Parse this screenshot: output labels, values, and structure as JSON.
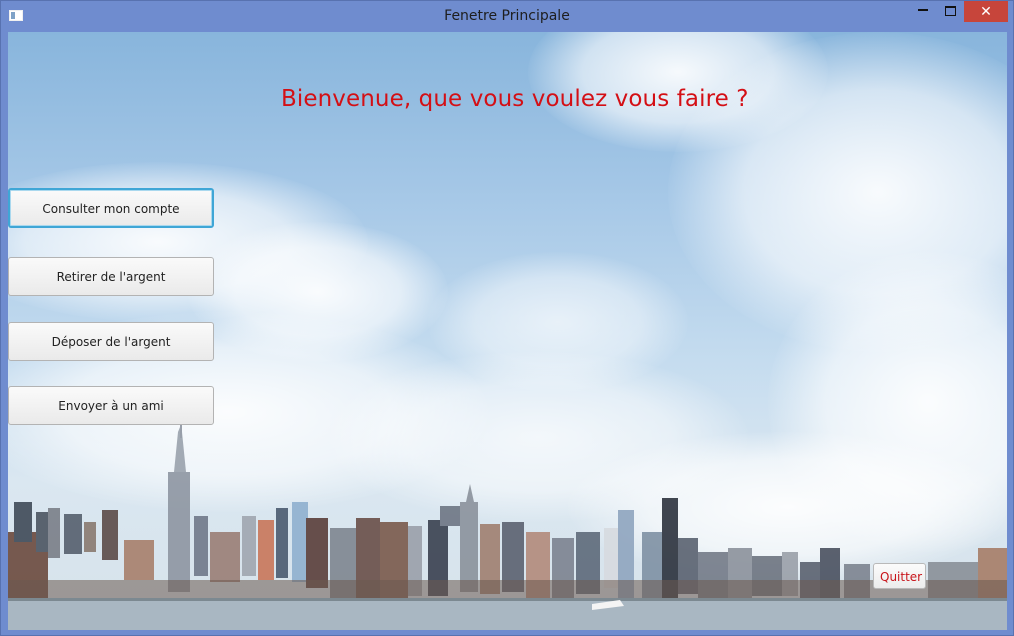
{
  "window": {
    "title": "Fenetre Principale",
    "close_symbol": "✕"
  },
  "main": {
    "welcome": "Bienvenue, que vous voulez vous faire ?",
    "buttons": [
      {
        "label": "Consulter mon compte"
      },
      {
        "label": "Retirer de l'argent"
      },
      {
        "label": "Déposer de l'argent"
      },
      {
        "label": "Envoyer à un ami"
      }
    ],
    "quit_label": "Quitter"
  },
  "colors": {
    "titlebar": "#6f8ccf",
    "close": "#c7453b",
    "welcome_text": "#d40f15",
    "focus_ring": "#3fa6d6"
  }
}
